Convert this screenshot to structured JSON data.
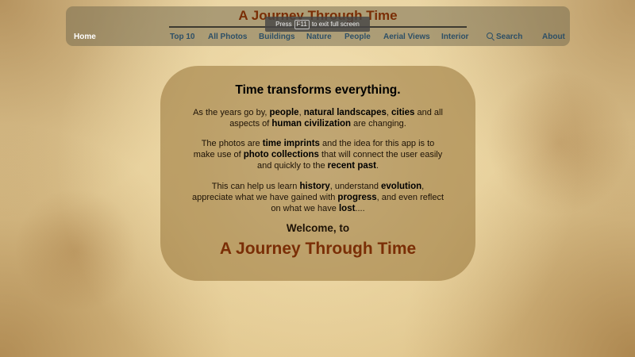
{
  "header": {
    "title": "A Journey Through Time"
  },
  "nav": {
    "home": "Home",
    "top10": "Top 10",
    "all_photos": "All Photos",
    "buildings": "Buildings",
    "nature": "Nature",
    "people": "People",
    "aerial_views": "Aerial Views",
    "interior": "Interior",
    "search": "Search",
    "about": "About",
    "search_icon": "search-icon"
  },
  "fullscreen_toast": {
    "press": "Press",
    "key": "F11",
    "rest": "to exit full screen"
  },
  "intro": {
    "heading": "Time transforms everything.",
    "p1": [
      "As the years go by, ",
      "people",
      ", ",
      "natural landscapes",
      ", ",
      "cities",
      " and all aspects of ",
      "human civilization",
      " are changing."
    ],
    "p2": [
      "The photos are ",
      "time imprints",
      " and the idea for this app is to make use of ",
      "photo collections",
      " that will connect the user easily and quickly to the ",
      "recent past",
      "."
    ],
    "p3": [
      "This can help us learn ",
      "history",
      ", understand ",
      "evolution",
      ", appreciate what we have gained with ",
      "progress",
      ", and even reflect on what we have ",
      "lost",
      "...."
    ],
    "welcome": "Welcome, to",
    "app_title": "A Journey Through Time"
  },
  "colors": {
    "title_brown": "#7a2e06",
    "nav_link": "#2d4f66",
    "nav_active": "#ffffff"
  }
}
